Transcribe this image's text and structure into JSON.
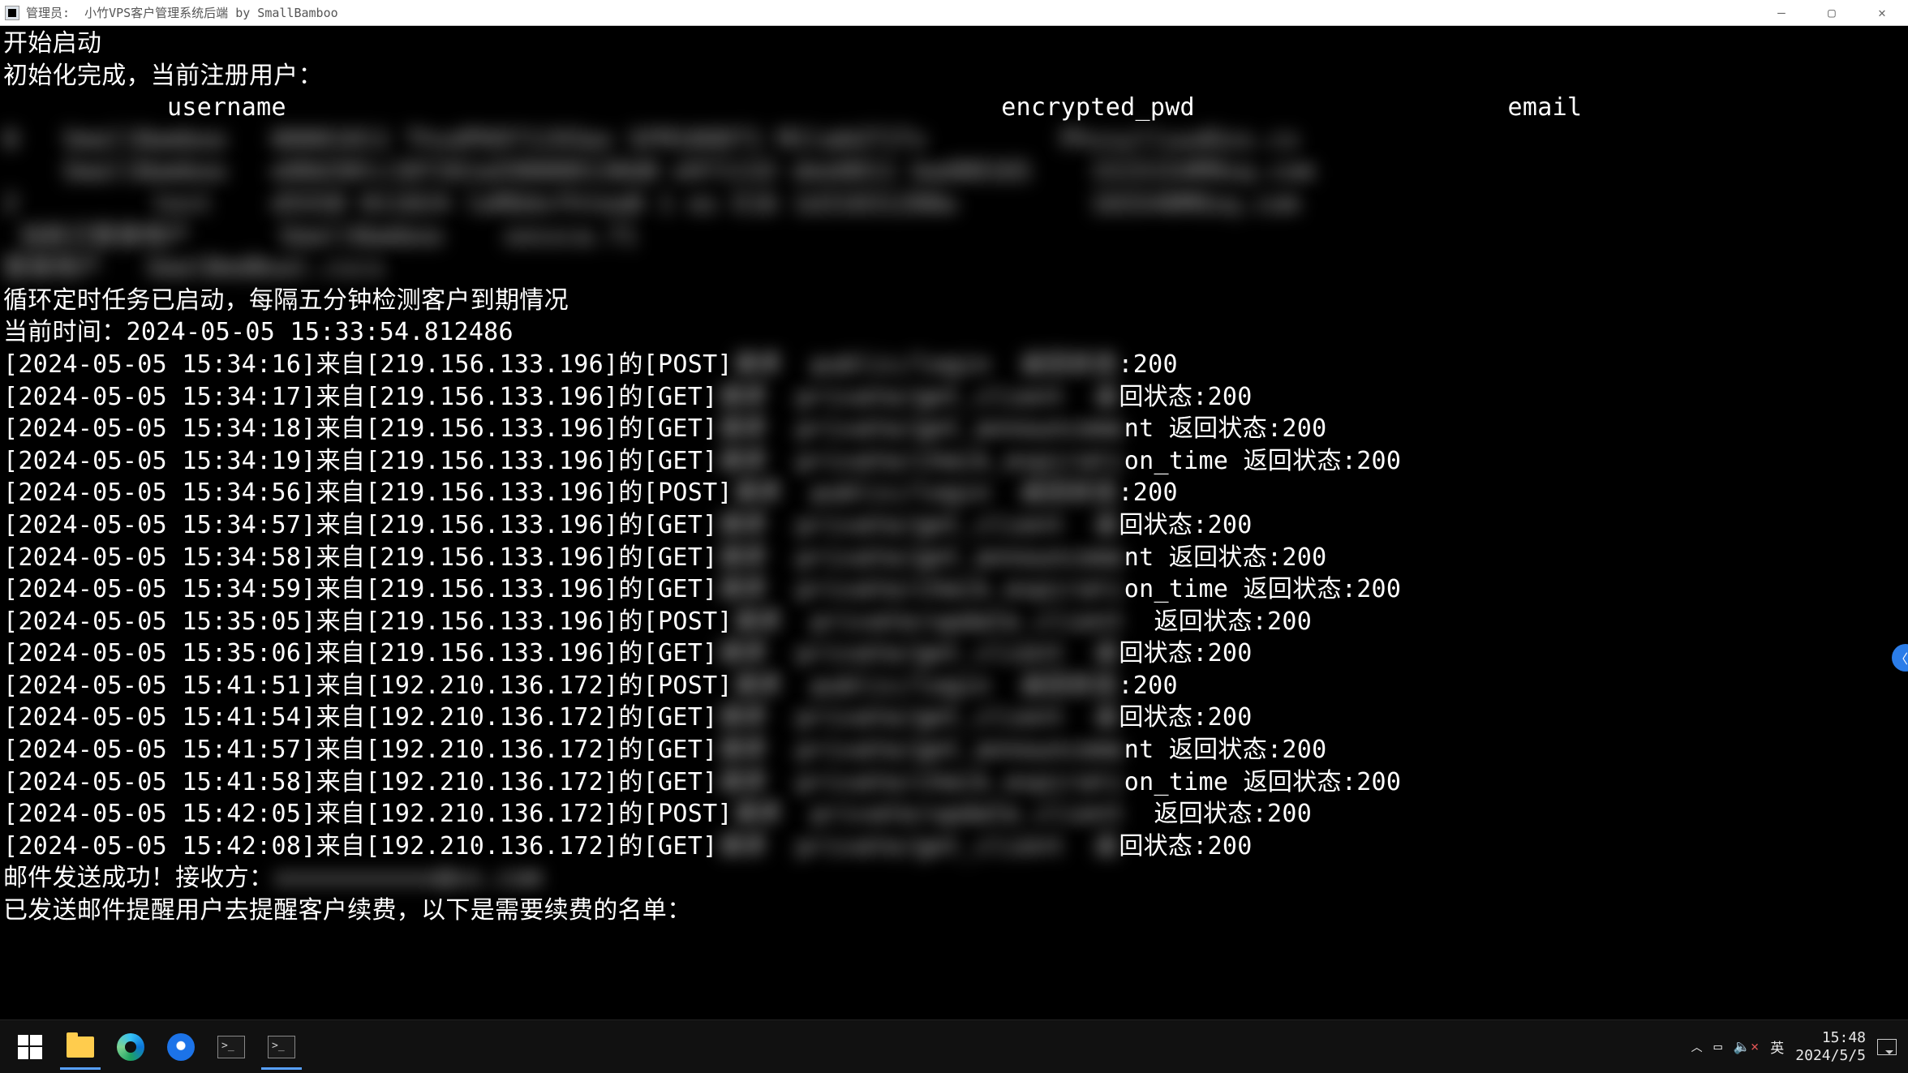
{
  "titlebar": {
    "prefix": "管理员:",
    "title": "小竹VPS客户管理系统后端 by SmallBamboo"
  },
  "content": {
    "start": "开始启动",
    "init": "初始化完成，当前注册用户：",
    "header_row": "           username                                                encrypted_pwd                     email",
    "blur_users": [
      "0   SmallBamboo   00001011 ThsdP6971193ax SFM10ODT1 M1labGT1Tx         PhssylluudGss.cs",
      "    SmallBamboo   e00d30tc18f261a590000130d8 e971132 dee0011 bad00165    1S15154M9sq.com",
      "2         test    d5550 011024 leRDdxfhtea8 1 es E16 1d31031200w         165540MOsq.com",
      " 当前己登录用户      SmallBamboo    sessca.71                                             ",
      "登录用户   SmalBmdBoal.cscs"
    ],
    "loop_start": "循环定时任务已启动，每隔五分钟检测客户到期情况",
    "now": "当前时间：2024-05-05 15:33:54.812486",
    "logs": [
      {
        "pre": "[2024-05-05 15:34:16]来自[219.156.133.196]的[POST]",
        "blur": "请求  public/login  返回状态",
        "post": ":200"
      },
      {
        "pre": "[2024-05-05 15:34:17]来自[219.156.133.196]的[GET]",
        "blur": "请求  private/get_client  返",
        "post": "回状态:200"
      },
      {
        "pre": "[2024-05-05 15:34:18]来自[219.156.133.196]的[GET]",
        "blur": "请求  private/get_announceme",
        "post": "nt 返回状态:200"
      },
      {
        "pre": "[2024-05-05 15:34:19]来自[219.156.133.196]的[GET]",
        "blur": "请求  private/check_expirati",
        "post": "on_time 返回状态:200"
      },
      {
        "pre": "[2024-05-05 15:34:56]来自[219.156.133.196]的[POST]",
        "blur": "请求  public/login  返回状态",
        "post": ":200"
      },
      {
        "pre": "[2024-05-05 15:34:57]来自[219.156.133.196]的[GET]",
        "blur": "请求  private/get_client  返",
        "post": "回状态:200"
      },
      {
        "pre": "[2024-05-05 15:34:58]来自[219.156.133.196]的[GET]",
        "blur": "请求  private/get_announceme",
        "post": "nt 返回状态:200"
      },
      {
        "pre": "[2024-05-05 15:34:59]来自[219.156.133.196]的[GET]",
        "blur": "请求  private/check_expirati",
        "post": "on_time 返回状态:200"
      },
      {
        "pre": "[2024-05-05 15:35:05]来自[219.156.133.196]的[POST]",
        "blur": "请求  private/update_client ",
        "post": " 返回状态:200"
      },
      {
        "pre": "[2024-05-05 15:35:06]来自[219.156.133.196]的[GET]",
        "blur": "请求  private/get_client  返",
        "post": "回状态:200"
      },
      {
        "pre": "[2024-05-05 15:41:51]来自[192.210.136.172]的[POST]",
        "blur": "请求  public/login  返回状态",
        "post": ":200"
      },
      {
        "pre": "[2024-05-05 15:41:54]来自[192.210.136.172]的[GET]",
        "blur": "请求  private/get_client  返",
        "post": "回状态:200"
      },
      {
        "pre": "[2024-05-05 15:41:57]来自[192.210.136.172]的[GET]",
        "blur": "请求  private/get_announceme",
        "post": "nt 返回状态:200"
      },
      {
        "pre": "[2024-05-05 15:41:58]来自[192.210.136.172]的[GET]",
        "blur": "请求  private/check_expirati",
        "post": "on_time 返回状态:200"
      },
      {
        "pre": "[2024-05-05 15:42:05]来自[192.210.136.172]的[POST]",
        "blur": "请求  private/update_client ",
        "post": " 返回状态:200"
      },
      {
        "pre": "[2024-05-05 15:42:08]来自[192.210.136.172]的[GET]",
        "blur": "请求  private/get_client  返",
        "post": "回状态:200"
      }
    ],
    "mail_sent_pre": "邮件发送成功！接收方：",
    "mail_sent_blur": "xxxxxxxxxxx@xx.com",
    "mail_notice": "已发送邮件提醒用户去提醒客户续费，以下是需要续费的名单："
  },
  "taskbar": {
    "ime": "英",
    "time": "15:48",
    "date": "2024/5/5"
  }
}
